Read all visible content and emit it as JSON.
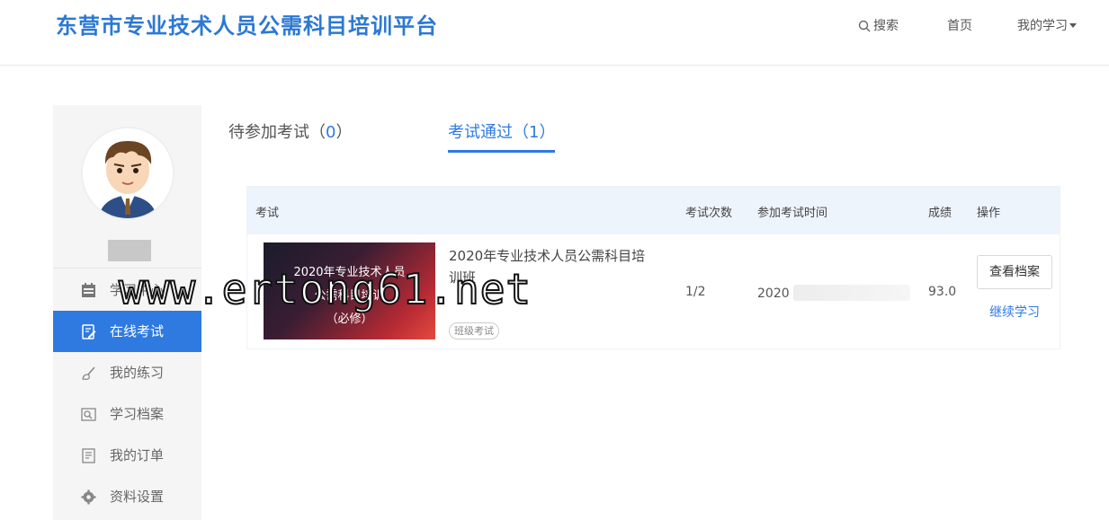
{
  "header": {
    "site_title": "东营市专业技术人员公需科目培训平台",
    "nav_search": "搜索",
    "nav_home": "首页",
    "nav_my": "我的学习"
  },
  "sidebar": {
    "items": [
      {
        "label": "学习中心",
        "icon": "calendar-icon"
      },
      {
        "label": "在线考试",
        "icon": "exam-icon",
        "active": true
      },
      {
        "label": "我的练习",
        "icon": "brush-icon"
      },
      {
        "label": "学习档案",
        "icon": "archive-icon"
      },
      {
        "label": "我的订单",
        "icon": "order-icon"
      },
      {
        "label": "资料设置",
        "icon": "gear-icon"
      }
    ]
  },
  "tabs": [
    {
      "label": "待参加考试（",
      "count": "0",
      "suffix": "）"
    },
    {
      "label": "考试通过（",
      "count": "1",
      "suffix": "）"
    }
  ],
  "table": {
    "headers": [
      "考试",
      "考试次数",
      "参加考试时间",
      "成绩",
      "操作"
    ],
    "rows": [
      {
        "thumb_lines": [
          "2020年专业技术人员",
          "公需科目培训",
          "（必修）"
        ],
        "title": "2020年专业技术人员公需科目培训班",
        "tag": "班级考试",
        "attempts": "1/2",
        "time": "2020",
        "score": "93.0",
        "archive_button": "查看档案",
        "continue_link": "继续学习"
      }
    ]
  },
  "watermark": "www.ertong61.net",
  "colors": {
    "accent": "#2f7ae0",
    "brand": "#2c78d4"
  }
}
